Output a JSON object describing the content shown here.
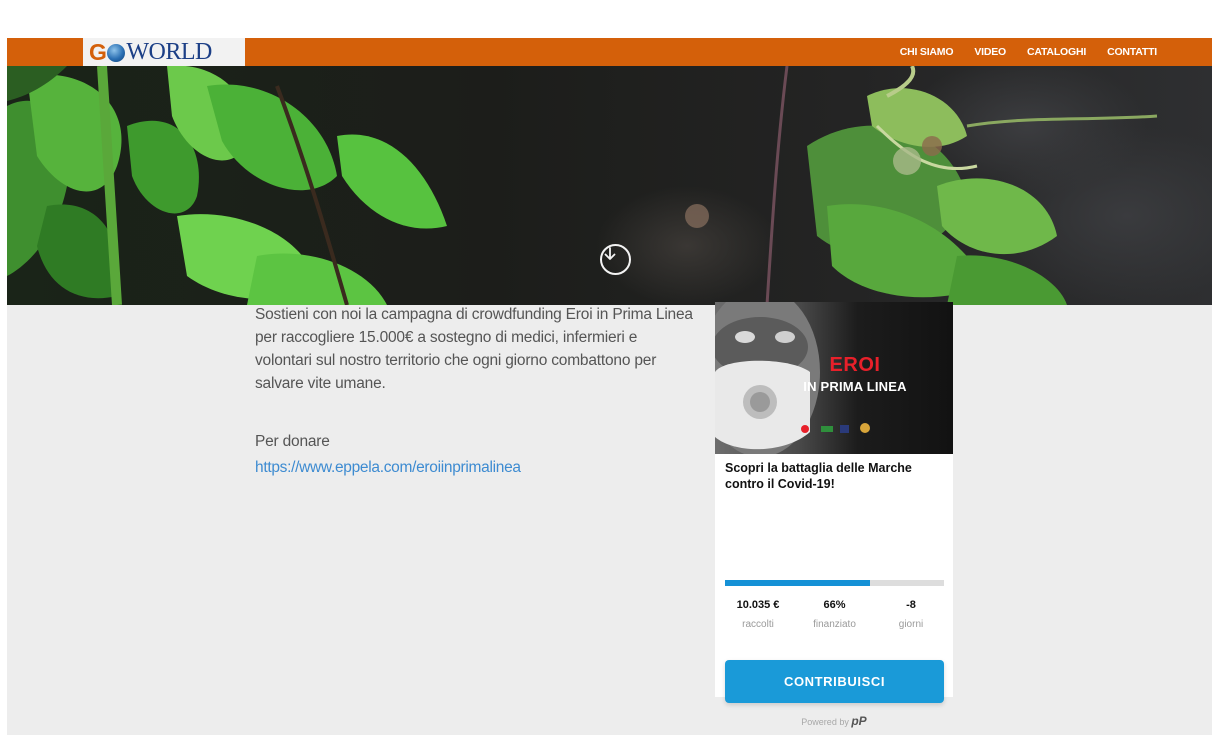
{
  "header": {
    "logo": {
      "go": "G",
      "world": "WORLD"
    },
    "nav": [
      {
        "label": "CHI SIAMO"
      },
      {
        "label": "VIDEO"
      },
      {
        "label": "CATALOGHI"
      },
      {
        "label": "CONTATTI"
      }
    ]
  },
  "hero": {
    "scroll_icon": "arrow-down-circle-icon"
  },
  "main": {
    "intro": "Sostieni con noi la campagna di crowdfunding Eroi in Prima Linea per raccogliere 15.000€ a sostegno di medici, infermieri e volontari sul nostro territorio che ogni giorno combattono per salvare vite umane.",
    "donate_label": "Per donare",
    "donate_link": "https://www.eppela.com/eroiinprimalinea"
  },
  "widget": {
    "image_text_1": "EROI",
    "image_text_2": "IN PRIMA LINEA",
    "title": "Scopri la battaglia delle Marche contro il Covid-19!",
    "progress": 0.66,
    "stats": [
      {
        "value": "10.035 €",
        "label": "raccolti"
      },
      {
        "value": "66%",
        "label": "finanziato"
      },
      {
        "value": "-8",
        "label": "giorni"
      }
    ],
    "button_label": "CONTRIBUISCI",
    "powered_by": "Powered by",
    "powered_brand": "pP"
  },
  "colors": {
    "navbar": "#d4600a",
    "accent_blue": "#1a9ad8",
    "link_blue": "#3d8bd1",
    "page_bg": "#ededed"
  }
}
